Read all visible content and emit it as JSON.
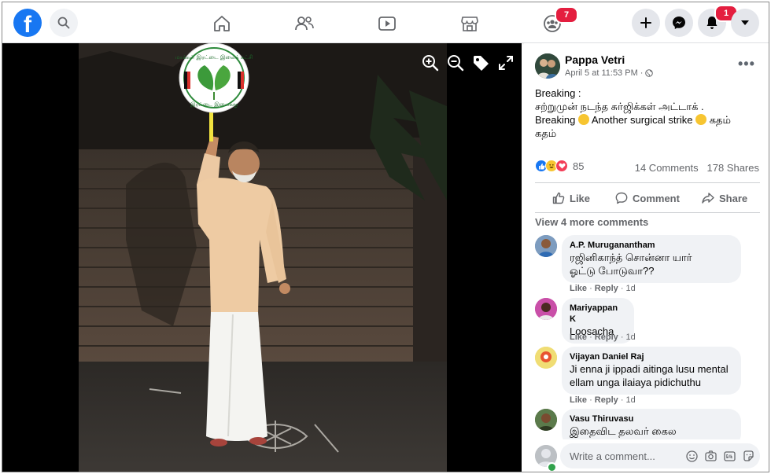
{
  "topbar": {
    "logo": "f",
    "groups_badge": "7",
    "notifications_badge": "1",
    "brand_color": "#1877f2"
  },
  "photo": {
    "sign_top": "மாக்கள் இரட்டை இலைக் கட்சி",
    "sign_bottom": "இரட்டை இலைக்கு"
  },
  "post": {
    "author": "Pappa Vetri",
    "timestamp": "April 5 at 11:53 PM",
    "text_line1": "Breaking :",
    "text_line2": "சற்றுமுன் நடந்த சுர்ஜிக்கள் அட்டாக் .",
    "text_line3_a": "Breaking",
    "text_line3_b": "Another surgical strike",
    "text_line3_c": "கதம்",
    "text_line4": "கதம்",
    "reaction_count": "85",
    "comments_count": "14 Comments",
    "shares_count": "178 Shares"
  },
  "actions": {
    "like": "Like",
    "comment": "Comment",
    "share": "Share"
  },
  "view_more": "View 4 more comments",
  "comments": [
    {
      "name": "A.P. Muruganantham",
      "line1": "ரஜினிகாந்த் சொன்னா யார்",
      "line2": "ஓட்டு போடுவா??",
      "like": "Like",
      "reply": "Reply",
      "age": "1d"
    },
    {
      "name": "Mariyappan K",
      "line1": "Loosacha",
      "line2": "",
      "like": "Like",
      "reply": "Reply",
      "age": "1d"
    },
    {
      "name": "Vijayan Daniel Raj",
      "line1": "Ji enna ji ippadi aitinga lusu mental",
      "line2": "ellam unga ilaiaya pidichuthu",
      "like": "Like",
      "reply": "Reply",
      "age": "1d"
    },
    {
      "name": "Vasu Thiruvasu",
      "line1": "இதைவிட தலவர் கைல",
      "line2": "",
      "like": "",
      "reply": "",
      "age": ""
    }
  ],
  "write_comment": {
    "placeholder": "Write a comment..."
  },
  "icons": {
    "home": "home-icon",
    "friends": "friends-icon",
    "watch": "watch-icon",
    "marketplace": "marketplace-icon",
    "groups": "groups-icon",
    "create": "plus-icon",
    "messenger": "messenger-icon",
    "notifications": "bell-icon",
    "account": "caret-down-icon"
  }
}
